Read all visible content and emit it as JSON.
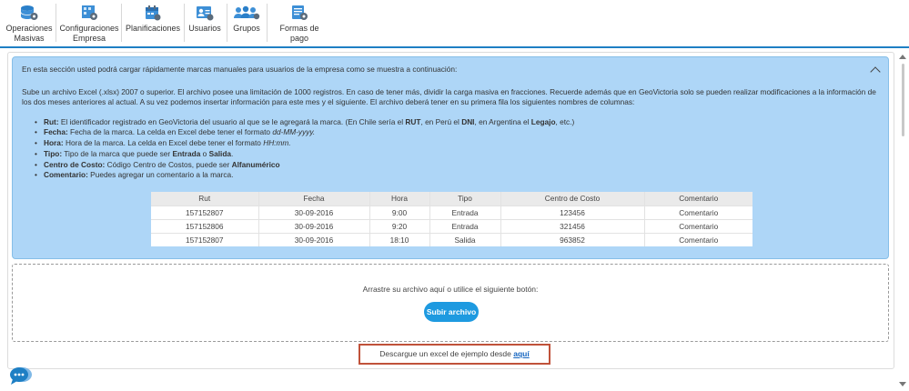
{
  "nav": {
    "items": [
      {
        "label_line1": "Operaciones",
        "label_line2": "Masivas",
        "icon": "database-gear-icon"
      },
      {
        "label_line1": "Configuraciones",
        "label_line2": "Empresa",
        "icon": "company-settings-icon"
      },
      {
        "label_line1": "Planificaciones",
        "label_line2": "",
        "icon": "calendar-icon"
      },
      {
        "label_line1": "Usuarios",
        "label_line2": "",
        "icon": "user-card-icon"
      },
      {
        "label_line1": "Grupos",
        "label_line2": "",
        "icon": "group-icon"
      },
      {
        "label_line1": "Formas de pago",
        "label_line2": "",
        "icon": "payment-settings-icon"
      }
    ],
    "accent_color": "#1e7fc4"
  },
  "info": {
    "intro": "En esta sección usted podrá cargar rápidamente marcas manuales para usuarios de la empresa como se muestra a continuación:",
    "paragraph": "Sube un archivo Excel (.xlsx) 2007 o superior. El archivo posee una limitación de 1000 registros. En caso de tener más, dividir la carga masiva en fracciones. Recuerde además que en GeoVictoria solo se pueden realizar modificaciones a la información de los dos meses anteriores al actual. A su vez podemos insertar información para este mes y el siguiente. El archivo deberá tener en su primera fila los siguientes nombres de columnas:",
    "bullets": {
      "rut_label": "Rut:",
      "rut_text1": " El identificador registrado en GeoVictoria del usuario al que se le agregará la marca. (En Chile sería el ",
      "rut_b1": "RUT",
      "rut_text2": ", en Perú el ",
      "rut_b2": "DNI",
      "rut_text3": ", en Argentina el ",
      "rut_b3": "Legajo",
      "rut_text4": ", etc.)",
      "fecha_label": "Fecha:",
      "fecha_text": " Fecha de la marca. La celda en Excel debe tener el formato ",
      "fecha_format": "dd-MM-yyyy.",
      "hora_label": "Hora:",
      "hora_text": " Hora de la marca. La celda en Excel debe tener el formato ",
      "hora_format": "HH:mm.",
      "tipo_label": "Tipo:",
      "tipo_text1": " Tipo de la marca que puede ser ",
      "tipo_b1": "Entrada",
      "tipo_text2": " o ",
      "tipo_b2": "Salida",
      "tipo_text3": ".",
      "cc_label": "Centro de Costo:",
      "cc_text": " Código Centro de Costos, puede ser ",
      "cc_b": "Alfanumérico",
      "com_label": "Comentario:",
      "com_text": " Puedes agregar un comentario a la marca."
    },
    "background_color": "#aed6f7"
  },
  "sample_table": {
    "headers": [
      "Rut",
      "Fecha",
      "Hora",
      "Tipo",
      "Centro de Costo",
      "Comentario"
    ],
    "rows": [
      [
        "157152807",
        "30-09-2016",
        "9:00",
        "Entrada",
        "123456",
        "Comentario"
      ],
      [
        "157152806",
        "30-09-2016",
        "9:20",
        "Entrada",
        "321456",
        "Comentario"
      ],
      [
        "157152807",
        "30-09-2016",
        "18:10",
        "Salida",
        "963852",
        "Comentario"
      ]
    ]
  },
  "dropzone": {
    "text": "Arrastre su archivo aquí o utilice el siguiente botón:",
    "button_label": "Subir archivo",
    "button_color": "#1e9ae0"
  },
  "download": {
    "text": "Descargue un excel de ejemplo desde ",
    "link_label": "aquí"
  }
}
